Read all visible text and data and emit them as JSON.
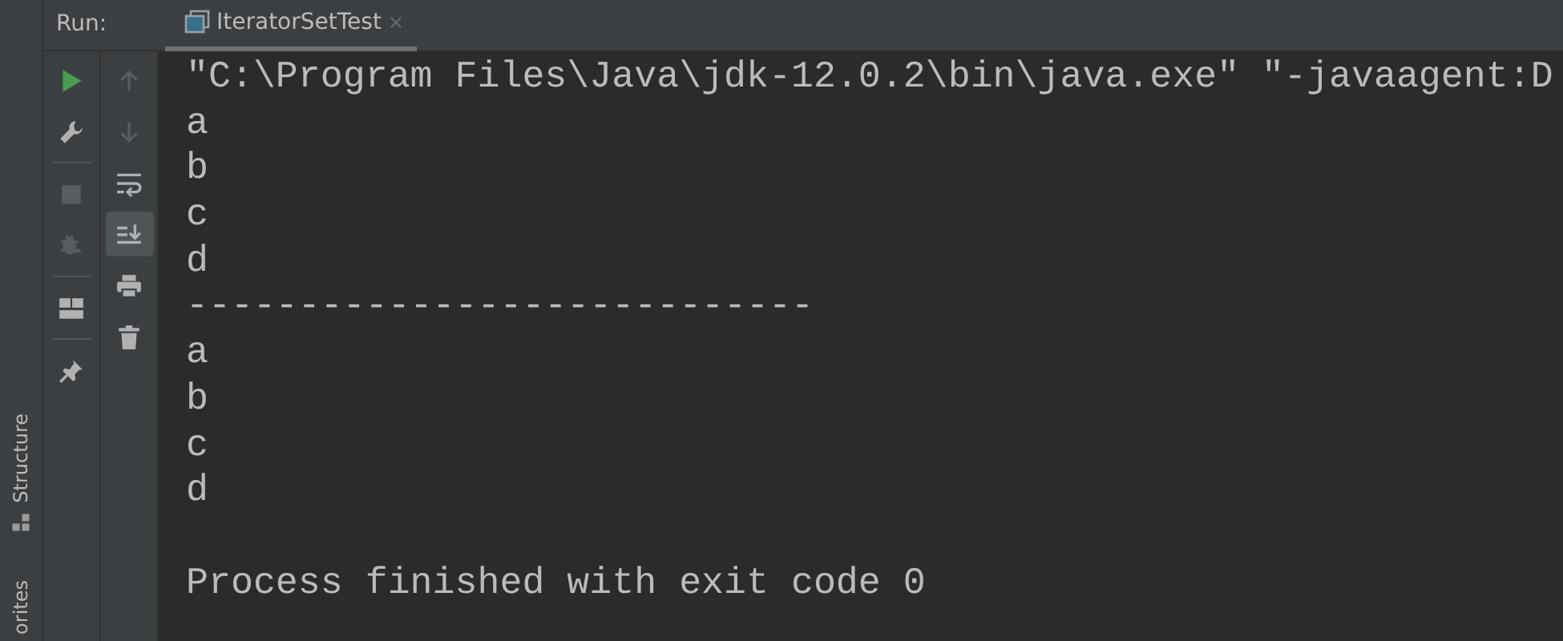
{
  "side_stripe": [
    {
      "label": "Structure",
      "kind": "structure"
    },
    {
      "label": "orites",
      "kind": "plain"
    }
  ],
  "run_panel": {
    "label": "Run:",
    "tabs": [
      {
        "label": "IteratorSetTest",
        "selected": true
      }
    ]
  },
  "left_toolbar": [
    {
      "kind": "run",
      "disabled": false
    },
    {
      "kind": "wrench",
      "disabled": false
    },
    {
      "kind": "separator"
    },
    {
      "kind": "stop",
      "disabled": true
    },
    {
      "kind": "debug",
      "disabled": true
    },
    {
      "kind": "separator"
    },
    {
      "kind": "layout",
      "disabled": false
    },
    {
      "kind": "separator"
    },
    {
      "kind": "pin",
      "disabled": false
    }
  ],
  "console_toolbar": [
    {
      "kind": "up",
      "disabled": true,
      "selected": false
    },
    {
      "kind": "down",
      "disabled": true,
      "selected": false
    },
    {
      "kind": "wrap",
      "disabled": false,
      "selected": false
    },
    {
      "kind": "scroll-end",
      "disabled": false,
      "selected": true
    },
    {
      "kind": "print",
      "disabled": false,
      "selected": false
    },
    {
      "kind": "trash",
      "disabled": false,
      "selected": false
    }
  ],
  "console_lines": [
    "\"C:\\Program Files\\Java\\jdk-12.0.2\\bin\\java.exe\" \"-javaagent:D",
    "a",
    "b",
    "c",
    "d",
    "----------------------------",
    "a",
    "b",
    "c",
    "d"
  ],
  "exit_message": "Process finished with exit code 0"
}
